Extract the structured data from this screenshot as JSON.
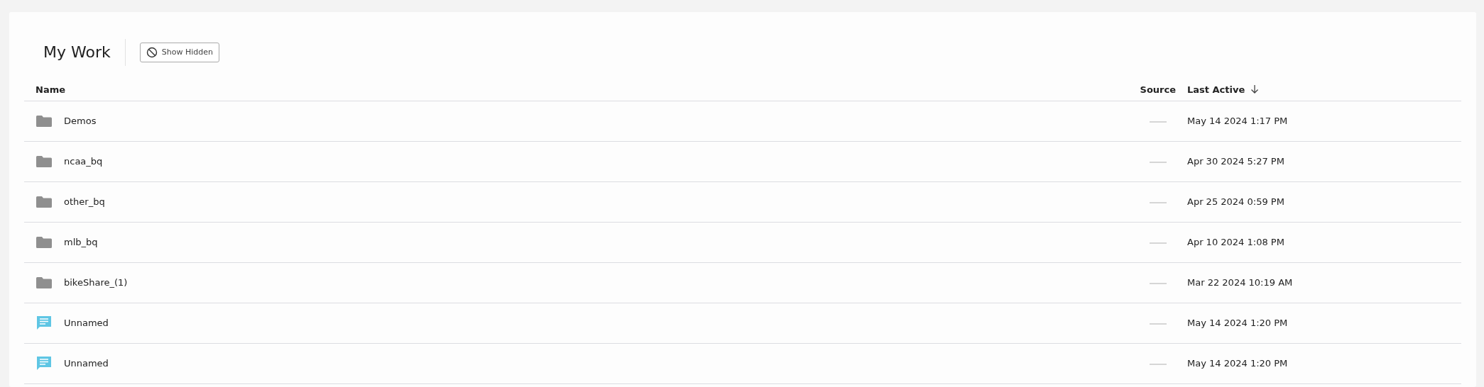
{
  "title": "My Work",
  "toolbar": {
    "show_hidden_button": "Show Hidden"
  },
  "table": {
    "columns": [
      {
        "label": "Name",
        "sorted": false
      },
      {
        "label": "Source",
        "sorted": false
      },
      {
        "label": "Last Active",
        "sorted": true
      }
    ],
    "rows": [
      {
        "kind": "folder",
        "name": "Demos",
        "last_active": "May 14 2024 1:17 PM"
      },
      {
        "kind": "folder",
        "name": "ncaa_bq",
        "last_active": "Apr 30 2024 5:27 PM"
      },
      {
        "kind": "folder",
        "name": "other_bq",
        "last_active": "Apr 25 2024 0:59 PM"
      },
      {
        "kind": "folder",
        "name": "mlb_bq",
        "last_active": "Apr 10 2024 1:08 PM"
      },
      {
        "kind": "folder",
        "name": "bikeShare_(1)",
        "last_active": "Mar 22 2024 10:19 AM"
      },
      {
        "kind": "report",
        "name": "Unnamed",
        "last_active": "May 14 2024 1:20 PM"
      },
      {
        "kind": "report",
        "name": "Unnamed",
        "last_active": "May 14 2024 1:20 PM"
      }
    ]
  }
}
